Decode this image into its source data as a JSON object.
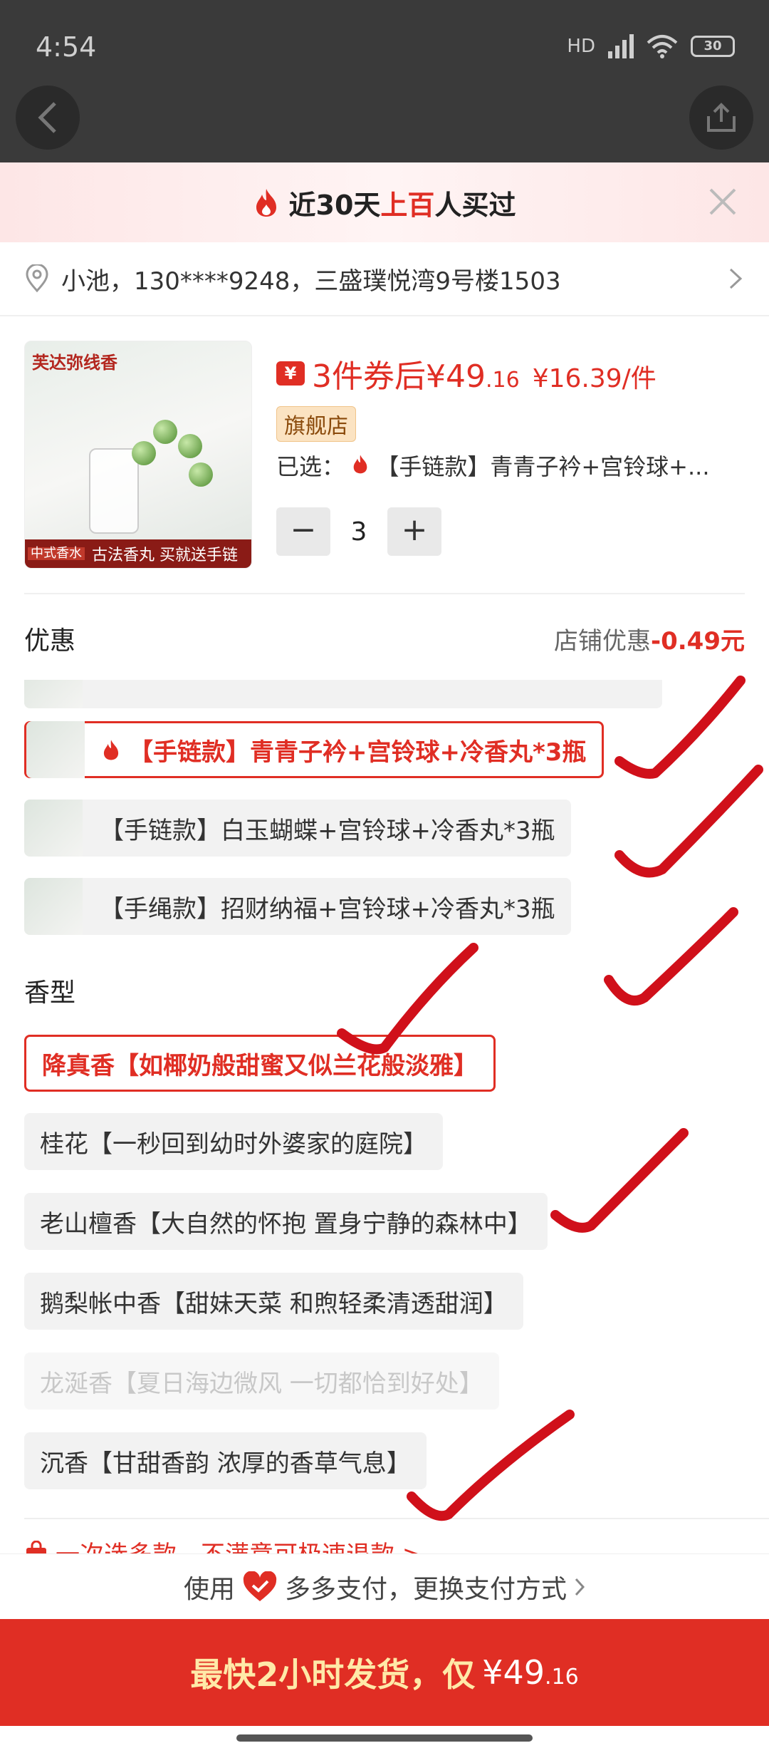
{
  "status_bar": {
    "time": "4:54",
    "network": "HD",
    "battery": "30"
  },
  "sheet": {
    "title_prefix": "近30天",
    "title_highlight": "上百",
    "title_suffix": "人买过"
  },
  "address": "小池，130****9248，三盛璞悦湾9号楼1503",
  "product": {
    "thumb_brand": "芙达弥线香",
    "thumb_tag": "中式香水",
    "thumb_footer": "古法香丸  买就送手链",
    "coupon_icon": "¥",
    "price_prefix": "3件券后¥49",
    "price_decimal": ".16",
    "price_per_item": "¥16.39/件",
    "store_badge": "旗舰店",
    "selected_label": "已选：",
    "selected_value": "【手链款】青青子衿+宫铃球+...",
    "quantity": "3",
    "minus": "−",
    "plus": "+"
  },
  "promo": {
    "label": "优惠",
    "value_prefix": "店铺优惠",
    "value": "-0.49元"
  },
  "style_options": [
    {
      "label": "【手链款】青青子衿+宫铃球+冷香丸*3瓶",
      "selected": true,
      "hot": true
    },
    {
      "label": "【手链款】白玉蝴蝶+宫铃球+冷香丸*3瓶",
      "selected": false,
      "hot": false
    },
    {
      "label": "【手绳款】招财纳福+宫铃球+冷香丸*3瓶",
      "selected": false,
      "hot": false
    }
  ],
  "scent_section_title": "香型",
  "scent_options": [
    {
      "label": "降真香【如椰奶般甜蜜又似兰花般淡雅】",
      "selected": true,
      "disabled": false
    },
    {
      "label": "桂花【一秒回到幼时外婆家的庭院】",
      "selected": false,
      "disabled": false
    },
    {
      "label": "老山檀香【大自然的怀抱 置身宁静的森林中】",
      "selected": false,
      "disabled": false
    },
    {
      "label": "鹅梨帐中香【甜妹天菜 和煦轻柔清透甜润】",
      "selected": false,
      "disabled": false
    },
    {
      "label": "龙涎香【夏日海边微风 一切都恰到好处】",
      "selected": false,
      "disabled": true
    },
    {
      "label": "沉香【甘甜香韵 浓厚的香草气息】",
      "selected": false,
      "disabled": false
    }
  ],
  "refund_notice": "一次选多款，不满意可极速退款 >",
  "payment": {
    "prefix": "使用",
    "method": "多多支付，更换支付方式"
  },
  "buy_button": {
    "label": "最快2小时发货，仅",
    "price": "¥49",
    "price_decimal": ".16"
  },
  "colors": {
    "accent": "#e02e24",
    "annotation": "#d0101a"
  }
}
